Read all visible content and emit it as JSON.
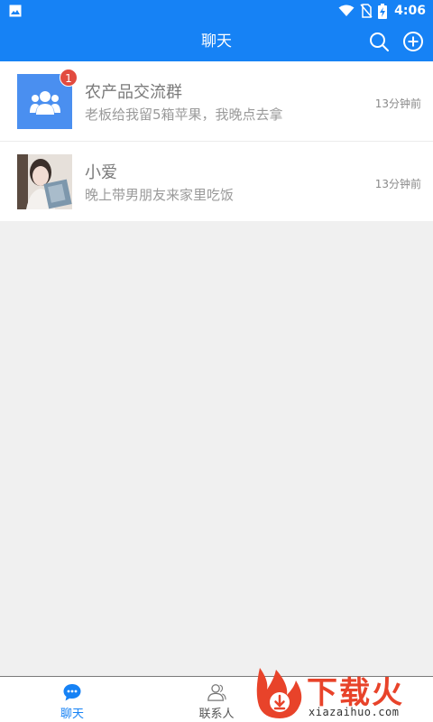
{
  "status_bar": {
    "time": "4:06",
    "icons": [
      "image-icon",
      "wifi-icon",
      "no-sim-icon",
      "battery-charging-icon"
    ]
  },
  "app_bar": {
    "title": "聊天",
    "actions": [
      "search-icon",
      "add-circle-icon"
    ]
  },
  "chats": [
    {
      "name": "农产品交流群",
      "preview": "老板给我留5箱苹果，我晚点去拿",
      "time": "13分钟前",
      "badge": "1",
      "avatar": "group-icon"
    },
    {
      "name": "小爱",
      "preview": "晚上带男朋友来家里吃饭",
      "time": "13分钟前",
      "avatar": "user-photo"
    }
  ],
  "bottom_nav": {
    "tabs": [
      {
        "label": "聊天",
        "icon": "chat-bubble-icon",
        "active": true
      },
      {
        "label": "联系人",
        "icon": "contacts-icon",
        "active": false
      }
    ]
  },
  "watermark": {
    "text": "下载火",
    "url": "xiazaihuo.com"
  },
  "colors": {
    "primary": "#1682f5",
    "badge": "#e24b3f",
    "background": "#f0f0f0",
    "watermark": "#e8432a"
  }
}
